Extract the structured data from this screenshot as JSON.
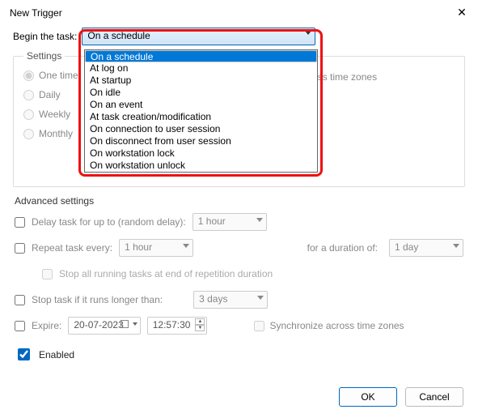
{
  "window": {
    "title": "New Trigger"
  },
  "begin": {
    "label": "Begin the task:",
    "selected": "On a schedule",
    "options": [
      "On a schedule",
      "At log on",
      "At startup",
      "On idle",
      "On an event",
      "At task creation/modification",
      "On connection to user session",
      "On disconnect from user session",
      "On workstation lock",
      "On workstation unlock"
    ]
  },
  "settings": {
    "legend": "Settings",
    "radios": {
      "one_time": "One time",
      "daily": "Daily",
      "weekly": "Weekly",
      "monthly": "Monthly"
    },
    "sync": "Synchronize across time zones"
  },
  "advanced": {
    "legend": "Advanced settings",
    "delay_label": "Delay task for up to (random delay):",
    "delay_value": "1 hour",
    "repeat_label": "Repeat task every:",
    "repeat_value": "1 hour",
    "duration_label": "for a duration of:",
    "duration_value": "1 day",
    "stop_all_label": "Stop all running tasks at end of repetition duration",
    "stop_longer_label": "Stop task if it runs longer than:",
    "stop_longer_value": "3 days",
    "expire_label": "Expire:",
    "expire_date": "20-07-2023",
    "expire_time": "12:57:30",
    "sync2": "Synchronize across time zones",
    "enabled_label": "Enabled"
  },
  "buttons": {
    "ok": "OK",
    "cancel": "Cancel"
  }
}
